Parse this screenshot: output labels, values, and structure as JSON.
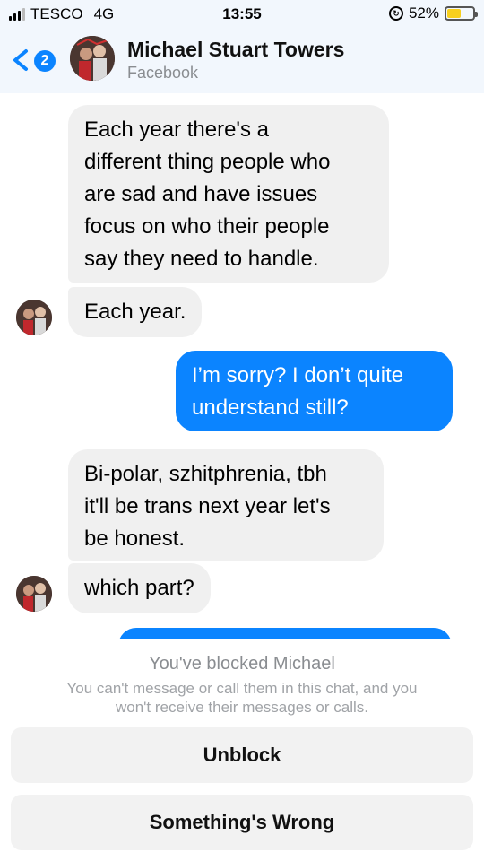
{
  "status_bar": {
    "carrier": "TESCO",
    "network": "4G",
    "time": "13:55",
    "battery_percent": "52%",
    "battery_level": 0.52,
    "battery_color": "#f7cf1d"
  },
  "header": {
    "back_badge": "2",
    "contact_name": "Michael Stuart Towers",
    "subtitle": "Facebook",
    "accent_color": "#0b84ff"
  },
  "messages": [
    {
      "direction": "incoming",
      "lines": [
        "Each year there's a",
        "different thing people who",
        "are sad and have issues",
        "focus on who their people",
        "say they need to handle."
      ]
    },
    {
      "direction": "incoming",
      "lines": [
        "Each year."
      ]
    },
    {
      "direction": "outgoing",
      "lines": [
        "I’m sorry? I don’t quite",
        "understand still?"
      ]
    },
    {
      "direction": "incoming",
      "lines": [
        "Bi-polar, szhitphrenia, tbh",
        "it'll be trans next year let's",
        "be honest."
      ]
    },
    {
      "direction": "incoming",
      "lines": [
        "which part?"
      ]
    }
  ],
  "blocked": {
    "title": "You've blocked Michael",
    "description_lines": [
      "You can't message or call them in this chat, and you",
      "won't receive their messages or calls."
    ],
    "unblock_label": "Unblock",
    "report_label": "Something's Wrong"
  }
}
